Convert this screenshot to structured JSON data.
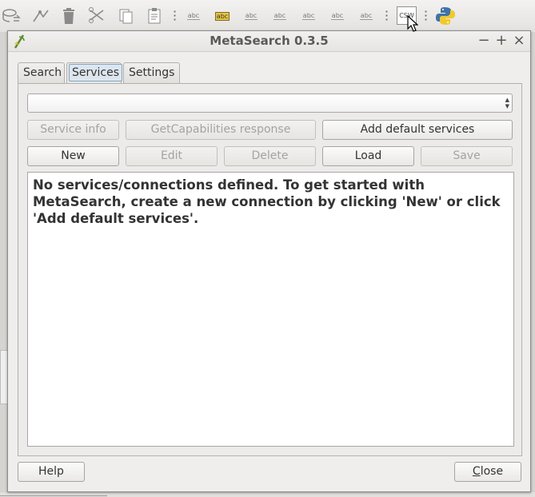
{
  "toolbar": {
    "abc_label": "abc",
    "csw_label": "CSW"
  },
  "window": {
    "title": "MetaSearch 0.3.5",
    "minimize_glyph": "−",
    "maximize_glyph": "+",
    "close_glyph": "×"
  },
  "tabs": [
    {
      "label": "Search",
      "active": false
    },
    {
      "label": "Services",
      "active": true
    },
    {
      "label": "Settings",
      "active": false
    }
  ],
  "services": {
    "combo_value": "",
    "buttons": {
      "service_info": "Service info",
      "getcapabilities": "GetCapabilities response",
      "add_default": "Add default services",
      "new": "New",
      "edit": "Edit",
      "delete": "Delete",
      "load": "Load",
      "save": "Save"
    },
    "message": "No services/connections defined. To get started with MetaSearch, create a new connection by clicking 'New' or click 'Add default services'."
  },
  "footer": {
    "help_label": "Help",
    "close_mnemonic": "C",
    "close_rest": "lose"
  }
}
